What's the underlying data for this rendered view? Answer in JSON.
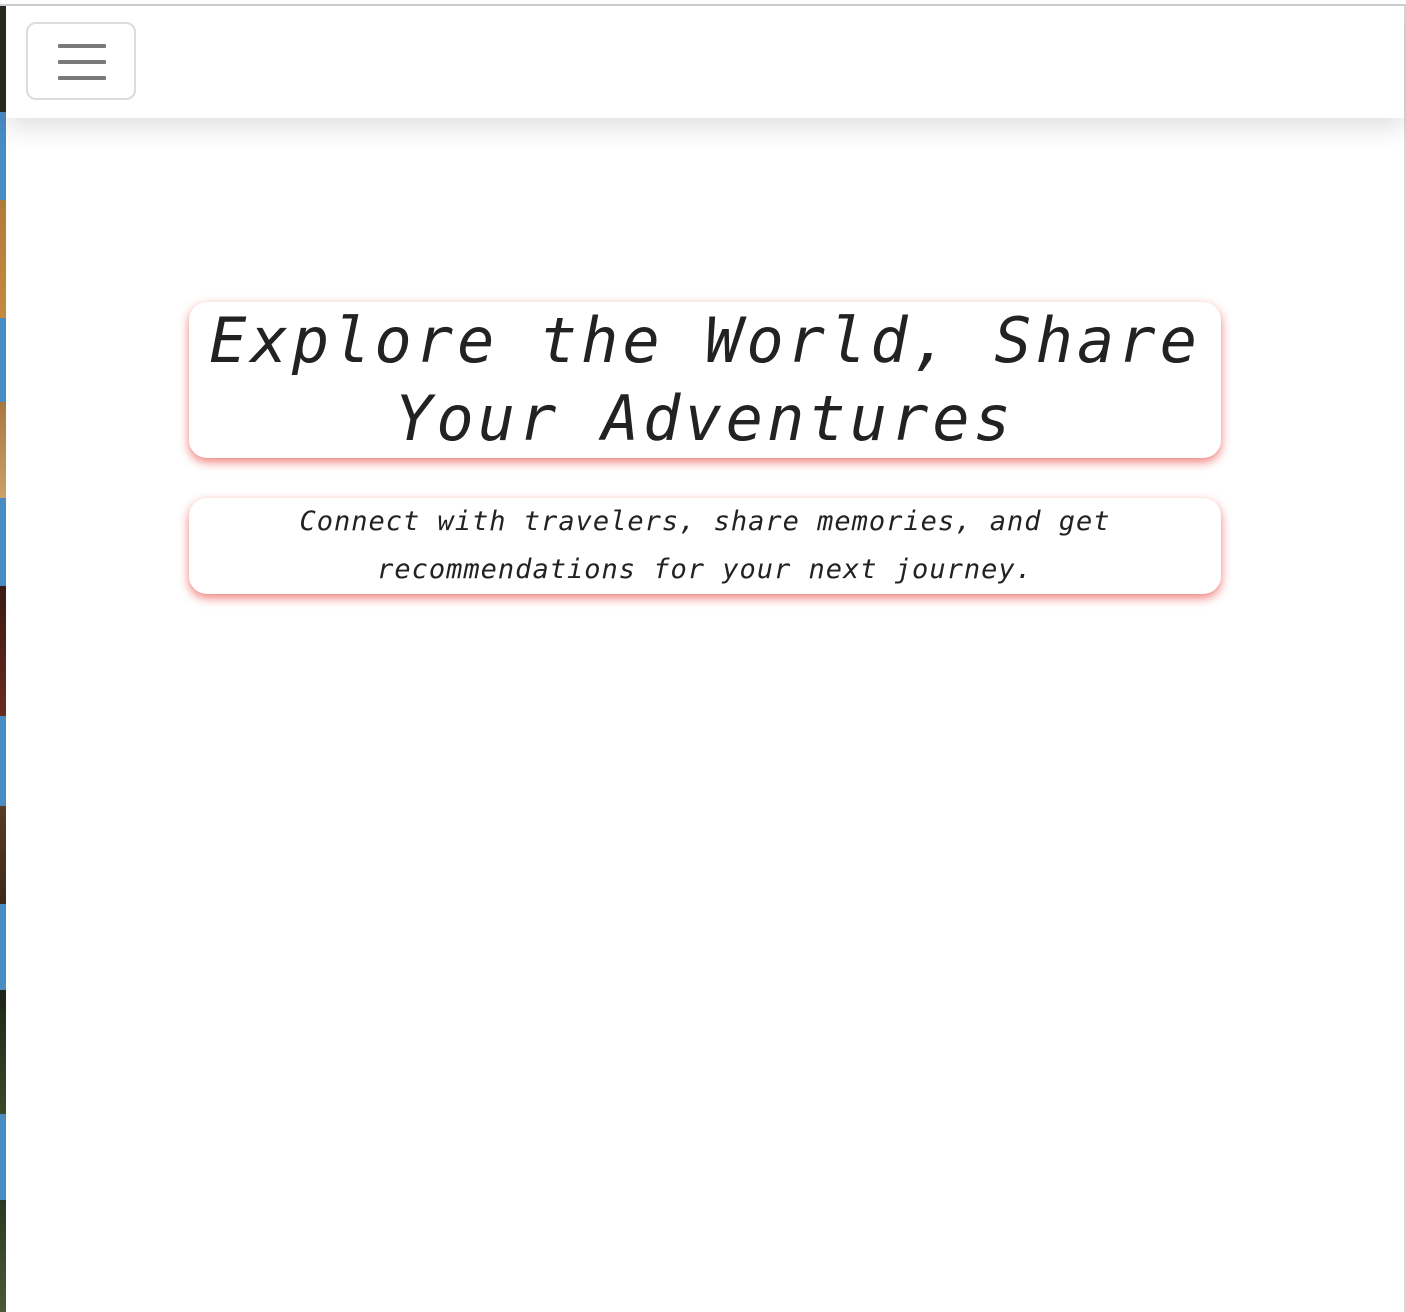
{
  "navbar": {
    "toggler_icon": "hamburger-menu-icon"
  },
  "hero": {
    "title": "Explore the World, Share Your Adventures",
    "subtitle": "Connect with travelers, share memories, and get recommendations for your next journey."
  },
  "colors": {
    "accent_shadow": "#e63c32",
    "text": "#222222",
    "toggler_bar": "#7a7a7a"
  }
}
